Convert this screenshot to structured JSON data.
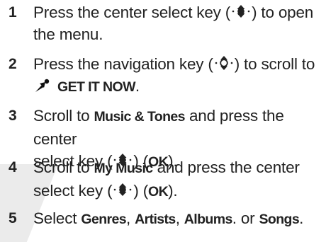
{
  "steps": [
    {
      "number": "1",
      "line1": {
        "before": "Press the center select key (",
        "after": ") to open"
      },
      "line2": "the menu."
    },
    {
      "number": "2",
      "line1": {
        "before": "Press the navigation key (",
        "after": ") to scroll to"
      },
      "menu_item": "GET IT NOW",
      "menu_suffix": "."
    },
    {
      "number": "3",
      "line1": {
        "before": "Scroll to ",
        "keyword": "Music & Tones",
        "after": " and press the center"
      },
      "line2": {
        "before": "select key (",
        "middle": ") (",
        "keyword": "OK",
        "after": ")."
      }
    },
    {
      "number": "4",
      "line1": {
        "before": "Scroll to ",
        "keyword": "My Music",
        "after": " and press the center"
      },
      "line2": {
        "before": "select key (",
        "middle": ") (",
        "keyword": "OK",
        "after": ")."
      }
    },
    {
      "number": "5",
      "line1": {
        "before": "Select ",
        "kw1": "Genres",
        "sep1": ", ",
        "kw2": "Artists",
        "sep2": ", ",
        "kw3": "Albums",
        "sep3": ". or ",
        "kw4": "Songs",
        "after": "."
      }
    }
  ],
  "icons": {
    "center_select": "center-select-key-icon",
    "navigation": "navigation-key-icon",
    "get_it_now": "get-it-now-icon"
  },
  "colors": {
    "text": "#222222",
    "shade": "#e8e8e8"
  }
}
